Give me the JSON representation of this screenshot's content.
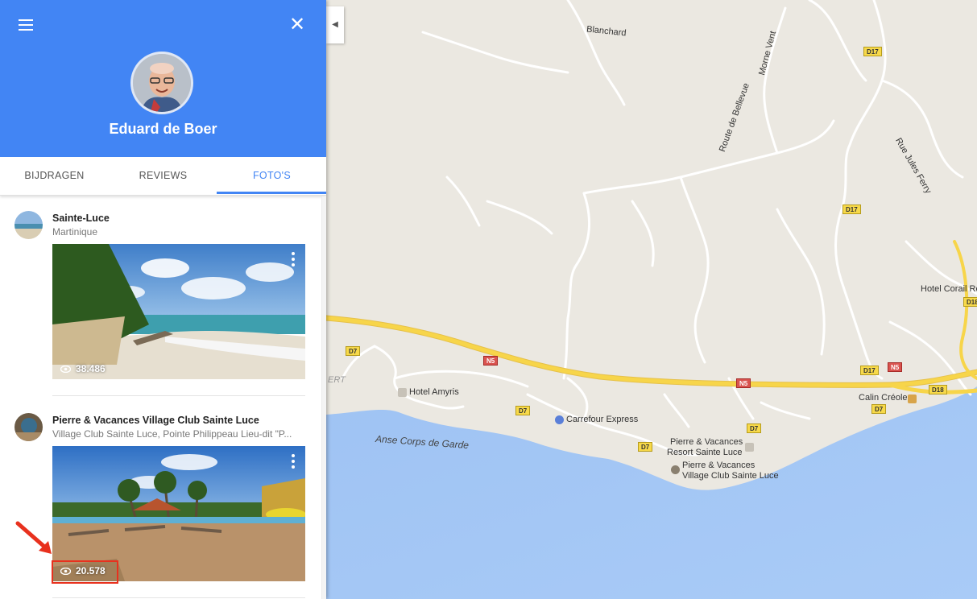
{
  "profile": {
    "name": "Eduard de Boer"
  },
  "tabs": [
    {
      "label": "BIJDRAGEN"
    },
    {
      "label": "REVIEWS"
    },
    {
      "label": "FOTO'S"
    }
  ],
  "photos": [
    {
      "title": "Sainte-Luce",
      "subtitle": "Martinique",
      "views": "38.486"
    },
    {
      "title": "Pierre & Vacances Village Club Sainte Luce",
      "subtitle": "Village Club Sainte Luce, Pointe Philippeau Lieu-dit \"P...",
      "views": "20.578"
    }
  ],
  "map": {
    "streets": [
      "Blanchard",
      "Morne Vent",
      "Route de Bellevue",
      "Rue Jules Ferry"
    ],
    "places": [
      "Hotel Corail Re",
      "Hotel Amyris",
      "Carrefour Express",
      "Calin Créole",
      "Pierre & Vacances",
      "Resort Sainte Luce",
      "Pierre & Vacances",
      "Village Club Sainte Luce",
      "ERT"
    ],
    "water": "Anse Corps de Garde",
    "road_labels": [
      "D17",
      "D17",
      "D17",
      "D18",
      "D7",
      "D7",
      "D7",
      "D7",
      "D7",
      "N5",
      "N5",
      "N5",
      "D18"
    ]
  },
  "colors": {
    "header_blue": "#4285f4",
    "highlight_red": "#e8311e",
    "sea": "#a9cbf7",
    "land": "#ebe8e1",
    "highway": "#f7d54a"
  },
  "icons": [
    "menu-icon",
    "close-icon",
    "more-vert-icon",
    "eye-icon",
    "chevron-left-icon",
    "shopping-icon",
    "hotel-icon",
    "restaurant-icon",
    "resort-icon"
  ]
}
